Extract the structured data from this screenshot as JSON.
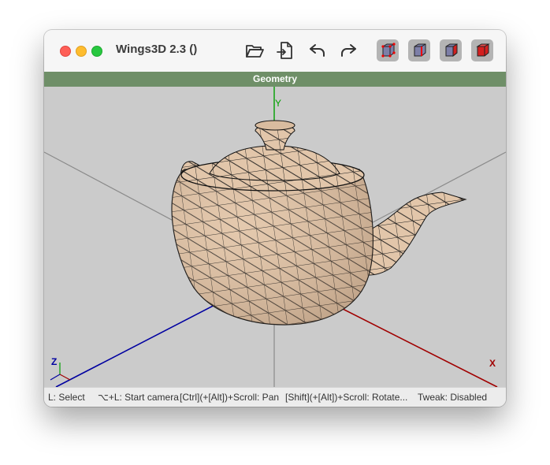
{
  "window": {
    "title": "Wings3D 2.3 ()"
  },
  "toolbar": {
    "buttons": [
      {
        "icon": "folder-open-icon"
      },
      {
        "icon": "import-icon"
      },
      {
        "icon": "undo-icon"
      },
      {
        "icon": "redo-icon"
      }
    ],
    "selection_modes": [
      {
        "icon": "vertex-mode-icon",
        "selected": false
      },
      {
        "icon": "edge-mode-icon",
        "selected": false
      },
      {
        "icon": "face-mode-icon",
        "selected": false
      },
      {
        "icon": "body-mode-icon",
        "selected": true
      }
    ]
  },
  "panel": {
    "title": "Geometry"
  },
  "viewport": {
    "axes": {
      "y_label": "Y",
      "x_label": "X",
      "mini_z_label": "Z",
      "colors": {
        "x": "#a00000",
        "y": "#00a000",
        "z": "#0000a0"
      }
    },
    "model": {
      "name": "teapot",
      "fill": "#e2c6aa",
      "wire": "#111111"
    }
  },
  "status": {
    "select": "L: Select",
    "camera": "⌥+L: Start camera",
    "pan": "[Ctrl](+[Alt])+Scroll: Pan",
    "rotate": "[Shift](+[Alt])+Scroll: Rotate...",
    "tweak": "Tweak: Disabled"
  }
}
